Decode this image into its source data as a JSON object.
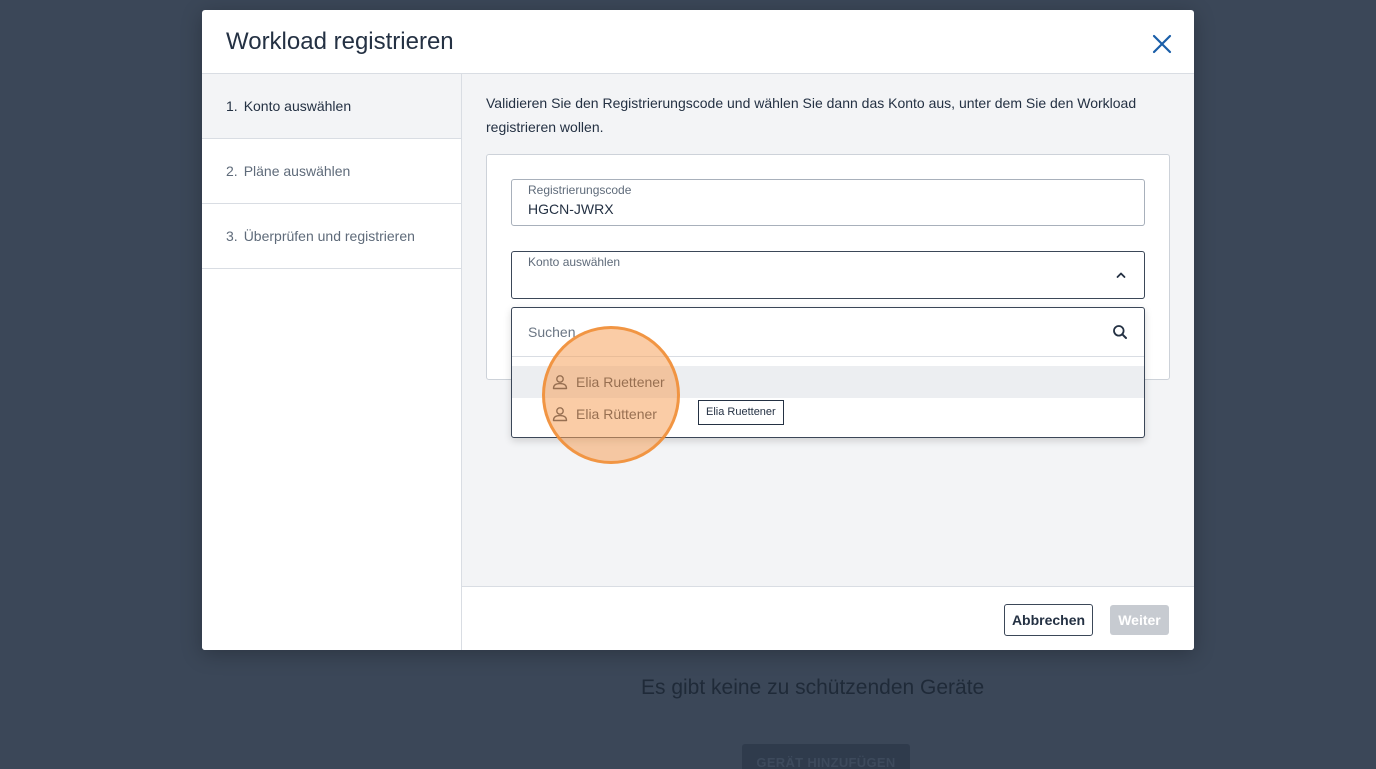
{
  "background": {
    "empty_message": "Es gibt keine zu schützenden Geräte",
    "add_device_button": "GERÄT HINZUFÜGEN"
  },
  "modal": {
    "title": "Workload registrieren",
    "close_icon": "close-icon"
  },
  "steps": [
    {
      "number": "1.",
      "label": "Konto auswählen",
      "active": true
    },
    {
      "number": "2.",
      "label": "Pläne auswählen",
      "active": false
    },
    {
      "number": "3.",
      "label": "Überprüfen und registrieren",
      "active": false
    }
  ],
  "content": {
    "intro": "Validieren Sie den Registrierungscode und wählen Sie dann das Konto aus, unter dem Sie den Workload registrieren wollen.",
    "code_field": {
      "label": "Registrierungscode",
      "value": "HGCN-JWRX"
    },
    "account_field": {
      "label": "Konto auswählen",
      "value": "",
      "icon": "chevron-up-icon"
    }
  },
  "dropdown": {
    "search_placeholder": "Suchen",
    "search_icon": "search-icon",
    "options": [
      {
        "label": "Elia Ruettener",
        "icon": "user-icon",
        "hovered": true
      },
      {
        "label": "Elia Rüttener",
        "icon": "user-icon",
        "hovered": false
      }
    ],
    "tooltip": "Elia Ruettener"
  },
  "footer": {
    "cancel_label": "Abbrechen",
    "next_label": "Weiter"
  },
  "colors": {
    "backdrop": "#3b4758",
    "accent": "#1a5ea8",
    "click_highlight": "#f6a35c"
  }
}
